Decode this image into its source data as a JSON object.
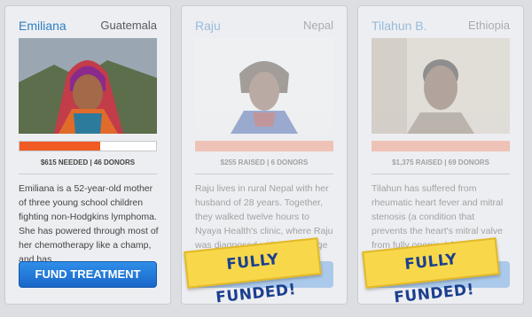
{
  "cards": [
    {
      "name": "Emiliana",
      "country": "Guatemala",
      "progress": 0.59,
      "stats": "$615 NEEDED | 46 DONORS",
      "description": "Emiliana is a 52-year-old mother of three young school children fighting non-Hodgkins lymphoma. She has powered through most of her chemotherapy like a champ, and has ...",
      "button": "FUND TREATMENT"
    },
    {
      "name": "Raju",
      "country": "Nepal",
      "progress": 1.0,
      "stats": "$255 RAISED | 6 DONORS",
      "description": "Raju lives in rural Nepal with her husband of 28 years. Together, they walked twelve hours to Nyaya Health's clinic, where Raju was diagnosed with a very large and",
      "stamp": "FULLY FUNDED!"
    },
    {
      "name": "Tilahun B.",
      "country": "Ethiopia",
      "progress": 1.0,
      "stats": "$1,375 RAISED | 69 DONORS",
      "description": "Tilahun has suffered from rheumatic heart fever and mitral stenosis (a condition that prevents the heart's mitral valve from fully opening) for the last thirteen years",
      "stamp": "FULLY FUNDED!"
    }
  ]
}
